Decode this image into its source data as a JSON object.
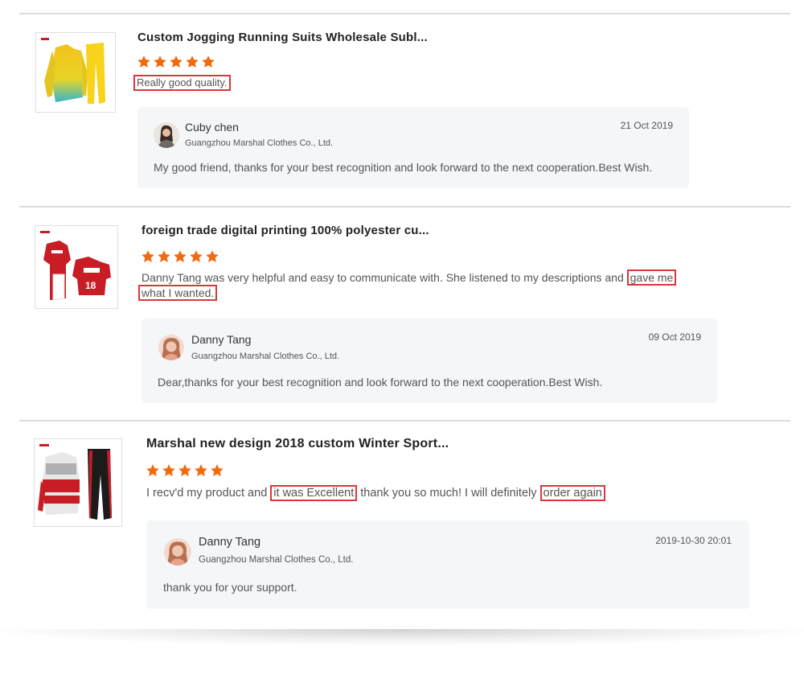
{
  "reviews": [
    {
      "product_title": "Custom Jogging Running Suits Wholesale Subl...",
      "rating": 5,
      "comment": "Really good quality.",
      "reply": {
        "name": "Cuby chen",
        "company": "Guangzhou Marshal Clothes Co., Ltd.",
        "date": "21 Oct 2019",
        "text": "My good friend, thanks for your best recognition and look forward to the next cooperation.Best Wish."
      }
    },
    {
      "product_title": "foreign trade digital printing 100% polyester cu...",
      "rating": 5,
      "comment_plain": "Danny Tang was very helpful and easy to communicate with. She listened to my descriptions and ",
      "comment_hl_1": "gave me",
      "comment_hl_2": "what I wanted.",
      "reply": {
        "name": "Danny Tang",
        "company": "Guangzhou Marshal Clothes Co., Ltd.",
        "date": "09 Oct 2019",
        "text": "Dear,thanks for your best recognition and look forward to the next cooperation.Best Wish."
      }
    },
    {
      "product_title": "Marshal new design 2018 custom Winter Sport...",
      "rating": 5,
      "comment_a": "I recv'd my product and ",
      "comment_hl_1": "it was Excellent",
      "comment_b": " thank you so much! I will definitely ",
      "comment_hl_2": "order again",
      "reply": {
        "name": "Danny Tang",
        "company": "Guangzhou Marshal Clothes Co., Ltd.",
        "date": "2019-10-30 20:01",
        "text": "thank you for your support."
      }
    }
  ],
  "colors": {
    "star": "#f26a0f",
    "highlight_border": "#d9383a",
    "reply_bg": "#f5f6f8"
  },
  "icons": {
    "star": "star-icon"
  }
}
